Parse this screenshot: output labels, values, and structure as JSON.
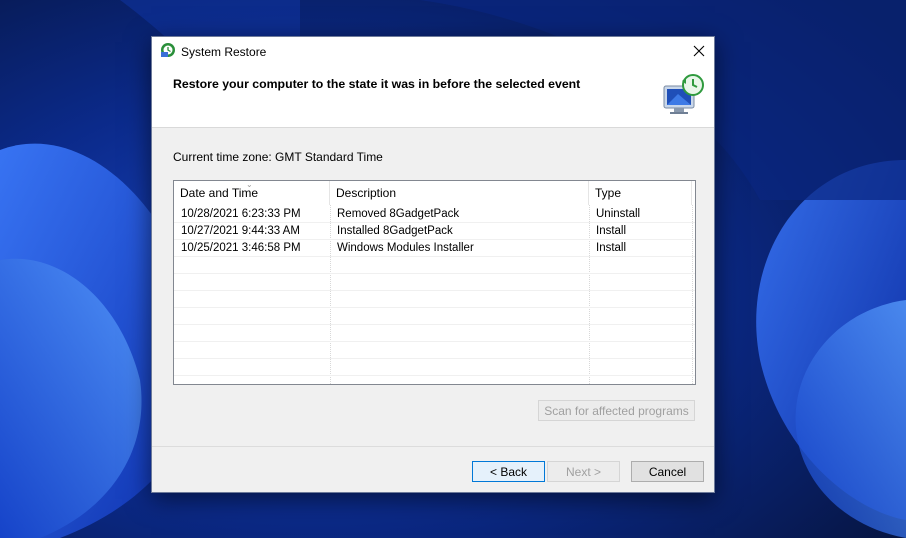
{
  "window": {
    "title": "System Restore",
    "close_icon": "close-icon"
  },
  "header": {
    "instruction": "Restore your computer to the state it was in before the selected event",
    "icon": "system-restore-icon"
  },
  "timezone_label": "Current time zone: GMT Standard Time",
  "restore_points": {
    "columns": [
      "Date and Time",
      "Description",
      "Type"
    ],
    "sorted_column": "Date and Time",
    "rows": [
      {
        "date": "10/28/2021 6:23:33 PM",
        "description": "Removed 8GadgetPack",
        "type": "Uninstall"
      },
      {
        "date": "10/27/2021 9:44:33 AM",
        "description": "Installed 8GadgetPack",
        "type": "Install"
      },
      {
        "date": "10/25/2021 3:46:58 PM",
        "description": "Windows Modules Installer",
        "type": "Install"
      }
    ]
  },
  "buttons": {
    "scan": "Scan for affected programs",
    "back": "< Back",
    "next": "Next >",
    "cancel": "Cancel"
  },
  "colors": {
    "dialog_bg": "#f0f0f0",
    "accent": "#0078d7",
    "wallpaper_base": "#0a1a4a"
  }
}
